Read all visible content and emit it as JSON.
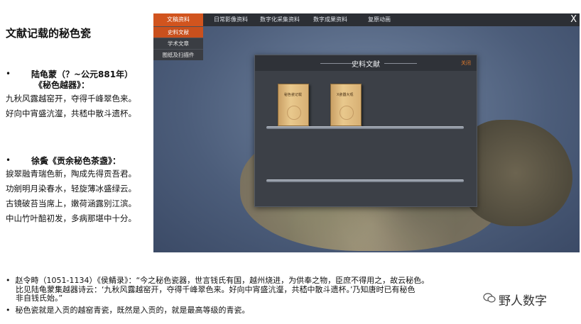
{
  "doc": {
    "title": "文献记载的秘色瓷",
    "section1": {
      "bullet": "•",
      "heading_line1": "陆龟蒙（？~公元881年）",
      "heading_line2": "《秘色越器》：",
      "poem_line1": "九秋风露越窑开，夺得千峰翠色来。",
      "poem_line2": "好向中宵盛沆瀣，共嵇中散斗遗杯。"
    },
    "section2": {
      "bullet": "•",
      "heading": "徐夤《贡余秘色茶盏》：",
      "poem_line1": "捩翠融青瑞色新，陶成先得贡吾君。",
      "poem_line2": "功剜明月染春水，轻旋薄冰盛绿云。",
      "poem_line3": "古镜破苔当席上，嫩荷涵露别江滨。",
      "poem_line4": "中山竹叶醅初发，多病那堪中十分。"
    },
    "bottom": {
      "line1": "•  赵令畤（1051-1134）《侯鲭录》：“今之秘色瓷器，世言钱氏有国，越州烧进，为供奉之物，臣庶不得用之，故云秘色。",
      "line2": "    比见陆龟蒙集越器诗云：‘九秋风露越窑开，夺得千峰翠色来。好向中宵盛沆瀣，共嵇中散斗遗杯。’乃知唐时已有秘色",
      "line3": "    非自钱氏始。”",
      "line4": "•  秘色瓷就是入贡的越窑青瓷，既然是入贡的，就是最高等级的青瓷。"
    },
    "brand": "野人数字"
  },
  "app": {
    "tabs": [
      "文稿资料",
      "日常影像资料",
      "数字化采集资料",
      "数字成果资料",
      "复原动画"
    ],
    "close": "X",
    "submenu": [
      "史料文献",
      "学术文章",
      "图纸及扫描件"
    ],
    "panel": {
      "title": "史料文献",
      "close": "关闭",
      "books": [
        "秘色瓷记载",
        "X瓷器大观"
      ]
    }
  },
  "colors": {
    "accent": "#d1541e",
    "panel": "#3c4047",
    "topbar": "#2c2f35"
  }
}
